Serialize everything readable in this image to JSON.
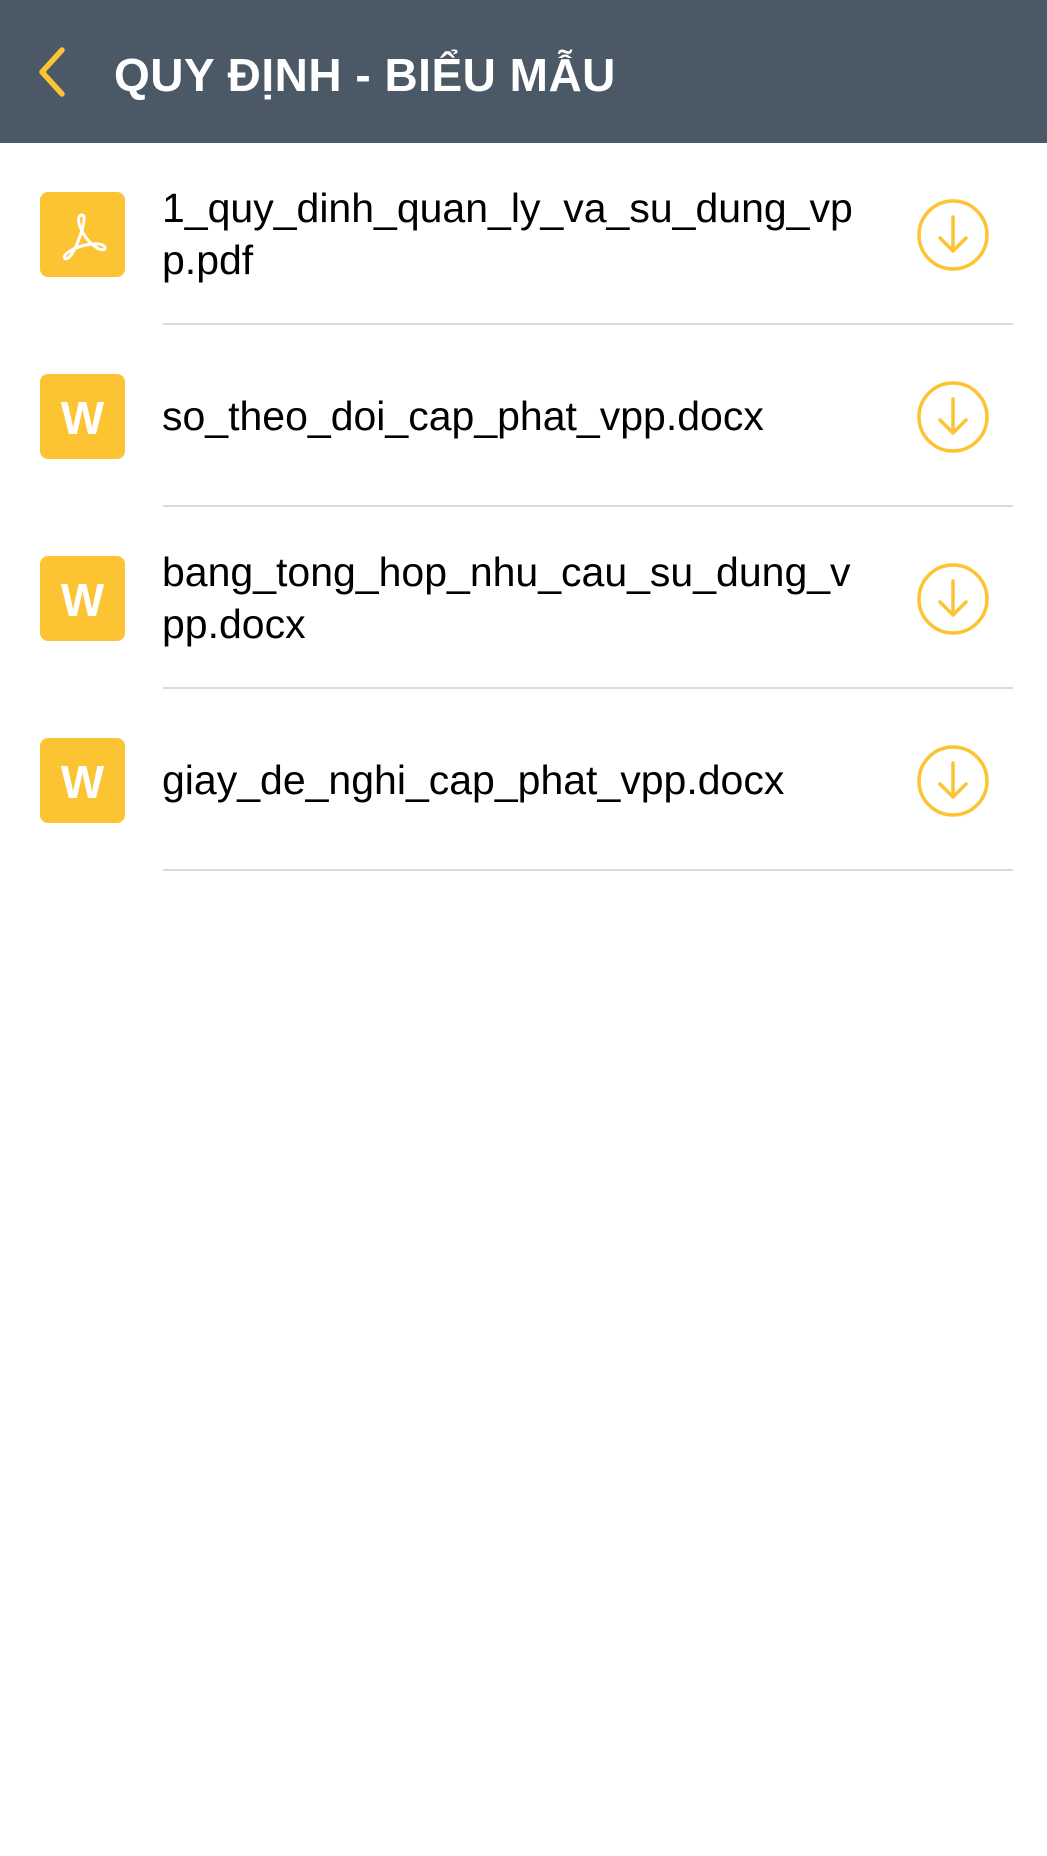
{
  "header": {
    "title": "QUY ĐỊNH - BIỂU MẪU",
    "back_icon": "chevron-left-icon",
    "background_color": "#4a5965",
    "accent_color": "#fcc433"
  },
  "files": [
    {
      "name": "1_quy_dinh_quan_ly_va_su_dung_vpp.pdf",
      "type": "pdf",
      "icon": "pdf-icon",
      "action_icon": "download-icon"
    },
    {
      "name": "so_theo_doi_cap_phat_vpp.docx",
      "type": "docx",
      "icon": "word-icon",
      "icon_letter": "W",
      "action_icon": "download-icon"
    },
    {
      "name": "bang_tong_hop_nhu_cau_su_dung_vpp.docx",
      "type": "docx",
      "icon": "word-icon",
      "icon_letter": "W",
      "action_icon": "download-icon"
    },
    {
      "name": "giay_de_nghi_cap_phat_vpp.docx",
      "type": "docx",
      "icon": "word-icon",
      "icon_letter": "W",
      "action_icon": "download-icon"
    }
  ]
}
